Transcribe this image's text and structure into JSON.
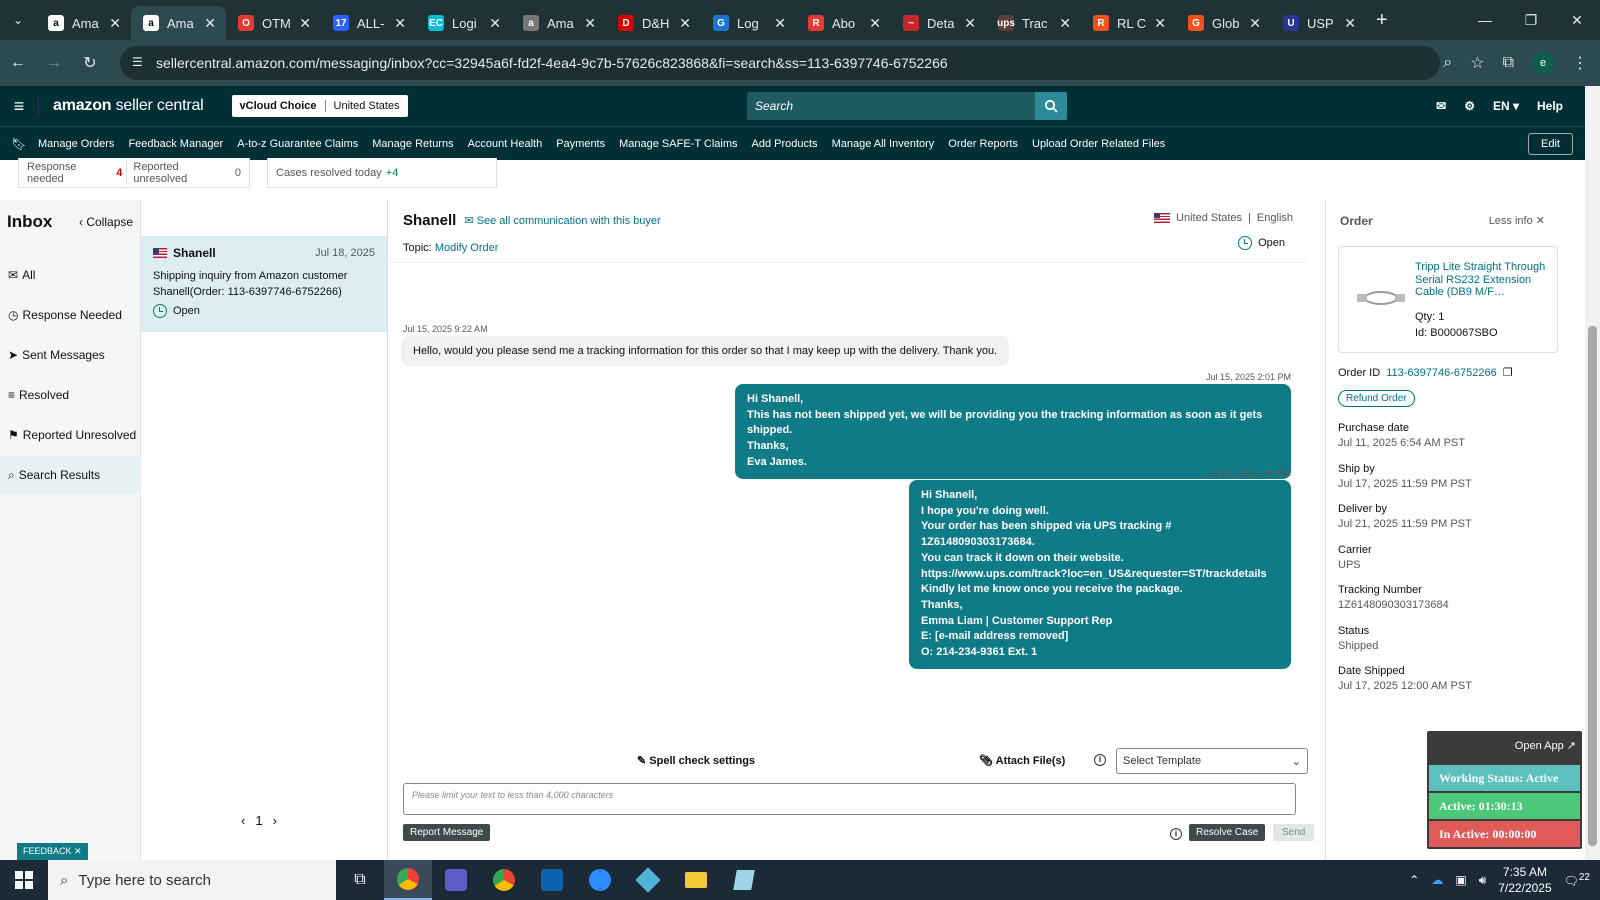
{
  "browser": {
    "tabs": [
      {
        "title": "Ama",
        "color": "#ffffff",
        "glyph": "a"
      },
      {
        "title": "Ama",
        "color": "#ffffff",
        "glyph": "a"
      },
      {
        "title": "OTM",
        "color": "#e53935",
        "glyph": "O"
      },
      {
        "title": "ALL-",
        "color": "#2962ff",
        "glyph": "17"
      },
      {
        "title": "Logi",
        "color": "#00bcd4",
        "glyph": "EC"
      },
      {
        "title": "Ama",
        "color": "#777777",
        "glyph": "a"
      },
      {
        "title": "D&H",
        "color": "#d50000",
        "glyph": "D"
      },
      {
        "title": "Log",
        "color": "#1976d2",
        "glyph": "G"
      },
      {
        "title": "Abo",
        "color": "#e53935",
        "glyph": "R"
      },
      {
        "title": "Deta",
        "color": "#c62828",
        "glyph": "~"
      },
      {
        "title": "Trac",
        "color": "#5d4037",
        "glyph": "ups"
      },
      {
        "title": "RL C",
        "color": "#f4511e",
        "glyph": "R"
      },
      {
        "title": "Glob",
        "color": "#f4511e",
        "glyph": "G"
      },
      {
        "title": "USP",
        "color": "#283593",
        "glyph": "U"
      }
    ],
    "active_tab_index": 1,
    "url": "sellercentral.amazon.com/messaging/inbox?cc=32945a6f-fd2f-4ea4-9c7b-57626c823868&fi=search&ss=113-6397746-6752266",
    "profile_initial": "e"
  },
  "header": {
    "logo_bold": "amazon",
    "logo_rest": " seller central",
    "store_name": "vCloud Choice",
    "marketplace": "United States",
    "search_placeholder": "Search",
    "lang": "EN",
    "help": "Help"
  },
  "nav_links": [
    "Manage Orders",
    "Feedback Manager",
    "A-to-z Guarantee Claims",
    "Manage Returns",
    "Account Health",
    "Payments",
    "Manage SAFE-T Claims",
    "Add Products",
    "Manage All Inventory",
    "Order Reports",
    "Upload Order Related Files"
  ],
  "nav_edit": "Edit",
  "stats": {
    "response_needed_label": "Response needed",
    "response_needed_count": "4",
    "reported_unresolved_label": "Reported unresolved",
    "reported_unresolved_count": "0",
    "cases_resolved_label": "Cases resolved today",
    "cases_resolved_delta": "+4"
  },
  "inbox": {
    "title": "Inbox",
    "collapse": "Collapse",
    "items": [
      "All",
      "Response Needed",
      "Sent Messages",
      "Resolved",
      "Reported Unresolved",
      "Search Results"
    ],
    "selected_index": 5
  },
  "conversation": {
    "name": "Shanell",
    "date": "Jul 18, 2025",
    "snippet_line1": "Shipping inquiry from Amazon customer",
    "snippet_line2": "Shanell(Order: 113-6397746-6752266)",
    "status": "Open",
    "page": "1"
  },
  "thread": {
    "buyer": "Shanell",
    "see_all": "See all communication with this buyer",
    "country": "United States",
    "language": "English",
    "topic_label": "Topic:",
    "topic": "Modify Order",
    "status": "Open",
    "messages": [
      {
        "time": "Jul 15, 2025 9:22 AM",
        "text": "Hello, would you please send me a tracking information for this order so that I may keep up with the delivery. Thank you."
      },
      {
        "time": "Jul 15, 2025 2:01 PM",
        "text": "Hi Shanell,\nThis has not been shipped yet, we will be providing you the tracking information as soon as it gets shipped.\nThanks,\nEva James."
      },
      {
        "time": "Jul 18, 2025 2:40 PM",
        "text": "Hi Shanell,\nI hope you're doing well.\nYour order has been shipped via UPS tracking # 1Z6148090303173684.\nYou can track it down on their website.\nhttps://www.ups.com/track?loc=en_US&requester=ST/trackdetails\nKindly let me know once you receive the package.\nThanks,\nEmma Liam | Customer Support Rep\n E: [e-mail address removed]\nO: 214-234-9361 Ext. 1"
      }
    ],
    "spell_check": "Spell check settings",
    "attach": "Attach File(s)",
    "template_placeholder": "Select Template",
    "composer_placeholder": "Please limit your text to less than 4,000 characters",
    "report": "Report Message",
    "resolve": "Resolve Case",
    "send": "Send"
  },
  "order": {
    "title": "Order",
    "less_info": "Less info",
    "product_title": "Tripp Lite Straight Through Serial RS232 Extension Cable (DB9 M/F…",
    "qty": "Qty: 1",
    "id": "Id: B000067SBO",
    "order_id_label": "Order ID",
    "order_id": "113-6397746-6752266",
    "refund": "Refund Order",
    "fields": [
      {
        "k": "Purchase date",
        "v": "Jul 11, 2025 6:54 AM PST"
      },
      {
        "k": "Ship by",
        "v": "Jul 17, 2025 11:59 PM PST"
      },
      {
        "k": "Deliver by",
        "v": "Jul 21, 2025 11:59 PM PST"
      },
      {
        "k": "Carrier",
        "v": "UPS"
      },
      {
        "k": "Tracking Number",
        "v": "1Z6148090303173684"
      },
      {
        "k": "Status",
        "v": "Shipped"
      },
      {
        "k": "Date Shipped",
        "v": "Jul 17, 2025 12:00 AM PST"
      }
    ]
  },
  "widget": {
    "open_app": "Open App ↗",
    "working": "Working Status: Active",
    "active": "Active: 01:30:13",
    "inactive": "In Active: 00:00:00",
    "colors": {
      "working": "#5bc0be",
      "active": "#4cc87a",
      "inactive": "#e05a5a"
    }
  },
  "feedback": "FEEDBACK ✕",
  "taskbar": {
    "search_placeholder": "Type here to search",
    "time": "7:35 AM",
    "date": "7/22/2025",
    "notifications": "22"
  }
}
